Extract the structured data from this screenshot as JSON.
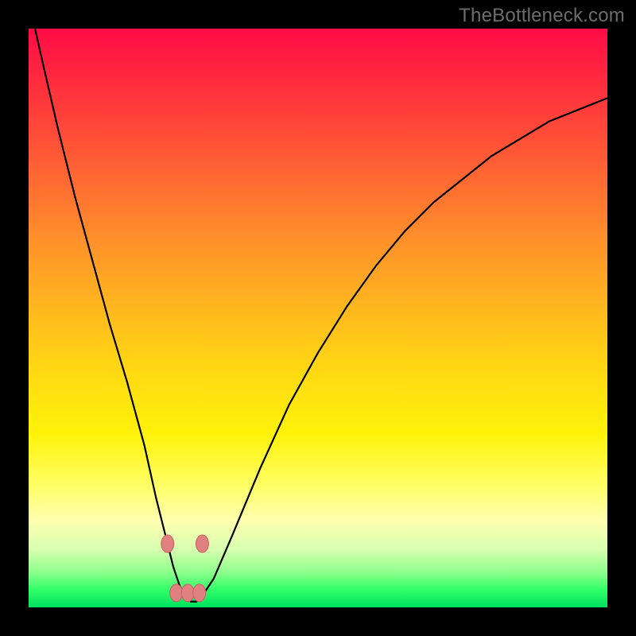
{
  "watermark": "TheBottleneck.com",
  "colors": {
    "frame": "#000000",
    "curve": "#000000",
    "marker_fill": "#e08080",
    "marker_stroke": "#c86060"
  },
  "chart_data": {
    "type": "line",
    "title": "",
    "xlabel": "",
    "ylabel": "",
    "xlim": [
      0,
      100
    ],
    "ylim": [
      0,
      100
    ],
    "grid": false,
    "legend": false,
    "series": [
      {
        "name": "bottleneck-curve",
        "x": [
          0,
          2,
          5,
          8,
          11,
          14,
          17,
          20,
          22,
          24,
          25,
          26,
          27,
          28,
          29,
          30,
          32,
          35,
          40,
          45,
          50,
          55,
          60,
          65,
          70,
          75,
          80,
          85,
          90,
          95,
          100
        ],
        "values": [
          105,
          96,
          83,
          71,
          60,
          49,
          39,
          28,
          19,
          11,
          7,
          4,
          2,
          1,
          1,
          2,
          5,
          12,
          24,
          35,
          44,
          52,
          59,
          65,
          70,
          74,
          78,
          81,
          84,
          86,
          88
        ]
      }
    ],
    "markers": [
      {
        "x": 24.0,
        "y": 11.0
      },
      {
        "x": 25.5,
        "y": 2.5
      },
      {
        "x": 27.5,
        "y": 2.5
      },
      {
        "x": 29.5,
        "y": 2.5
      },
      {
        "x": 30.0,
        "y": 11.0
      }
    ]
  }
}
